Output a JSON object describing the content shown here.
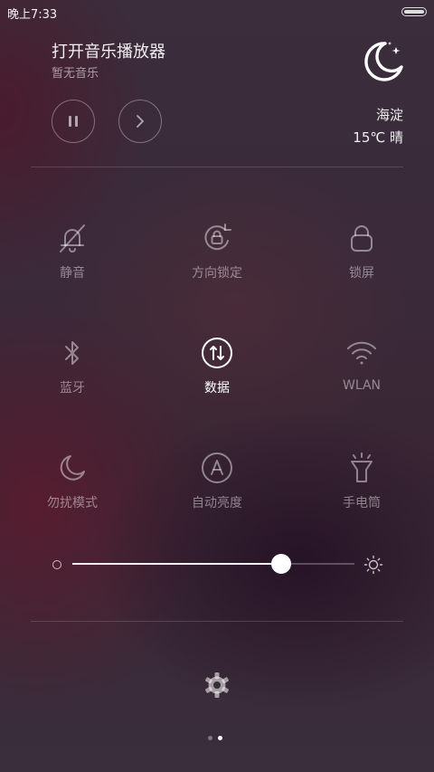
{
  "status_bar": {
    "time": "晚上7:33"
  },
  "music": {
    "title": "打开音乐播放器",
    "subtitle": "暂无音乐"
  },
  "weather": {
    "city": "海淀",
    "temp": "15℃  晴"
  },
  "toggles": [
    {
      "label": "静音",
      "icon": "bell-off-icon",
      "active": false
    },
    {
      "label": "方向锁定",
      "icon": "rotation-lock-icon",
      "active": false
    },
    {
      "label": "锁屏",
      "icon": "lock-icon",
      "active": false
    },
    {
      "label": "蓝牙",
      "icon": "bluetooth-icon",
      "active": false
    },
    {
      "label": "数据",
      "icon": "mobile-data-icon",
      "active": true
    },
    {
      "label": "WLAN",
      "icon": "wifi-icon",
      "active": false
    },
    {
      "label": "勿扰模式",
      "icon": "moon-icon",
      "active": false
    },
    {
      "label": "自动亮度",
      "icon": "auto-brightness-icon",
      "active": false
    },
    {
      "label": "手电筒",
      "icon": "flashlight-icon",
      "active": false
    }
  ],
  "brightness": {
    "level": 0.74
  },
  "pager": {
    "count": 2,
    "current": 1
  },
  "colors": {
    "active": "#ffffff",
    "inactive": "#9a8f9a"
  }
}
